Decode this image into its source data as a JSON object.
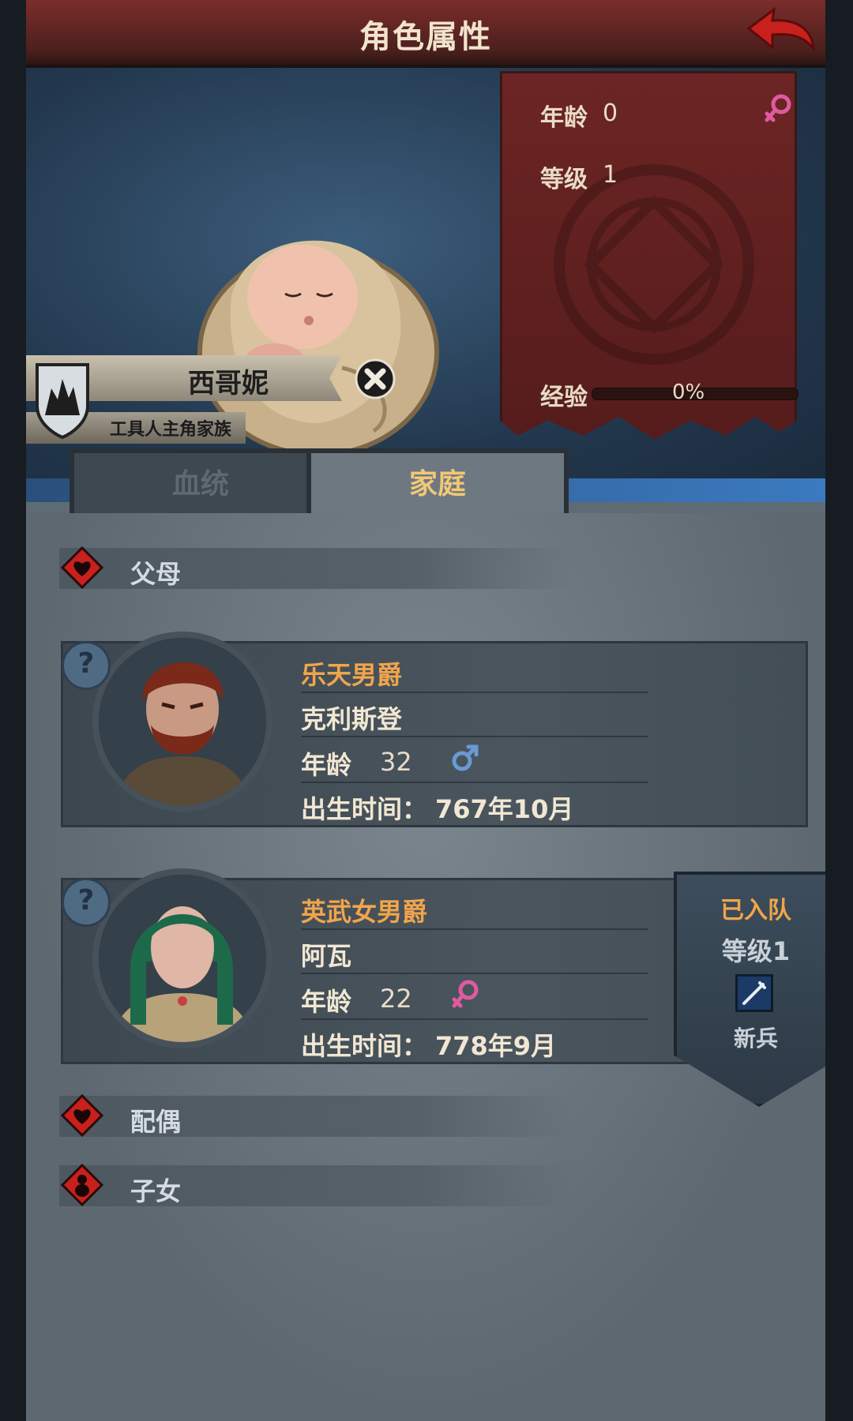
{
  "header": {
    "title": "角色属性",
    "back_icon": "back-arrow-icon"
  },
  "hero": {
    "name": "西哥妮",
    "family": "工具人主角家族",
    "stats": {
      "age_label": "年龄",
      "age_value": "0",
      "level_label": "等级",
      "level_value": "1",
      "exp_label": "经验",
      "exp_value": "0%",
      "exp_fraction": 0.0,
      "gender_icon": "female-icon"
    }
  },
  "tabs": [
    {
      "label": "血统",
      "active": false
    },
    {
      "label": "家庭",
      "active": true
    }
  ],
  "sections": {
    "parents": "父母",
    "spouse": "配偶",
    "children": "子女"
  },
  "parents": [
    {
      "title": "乐天男爵",
      "name": "克利斯登",
      "age_label": "年龄",
      "age": "32",
      "gender_icon": "male-icon",
      "birth_label": "出生时间：",
      "birth": "767年10月"
    },
    {
      "title": "英武女男爵",
      "name": "阿瓦",
      "age_label": "年龄",
      "age": "22",
      "gender_icon": "female-icon",
      "birth_label": "出生时间：",
      "birth": "778年9月"
    }
  ],
  "joined_badge": {
    "title": "已入队",
    "level": "等级1",
    "role": "新兵",
    "icon": "sword-icon"
  },
  "colors": {
    "accent": "#f0a54b",
    "header": "#6b2624",
    "female": "#e05aa0",
    "male": "#6a9ad4"
  }
}
